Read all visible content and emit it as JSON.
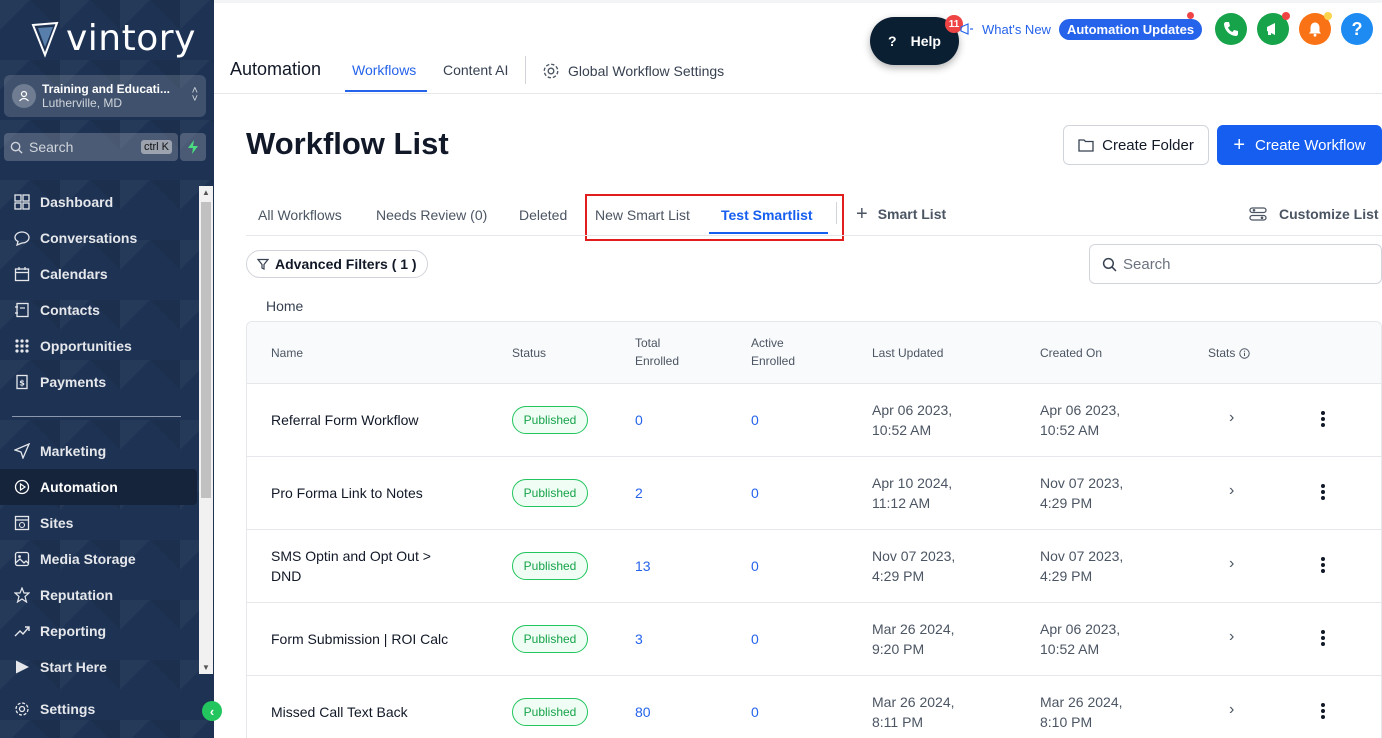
{
  "brand": {
    "name": "vintory"
  },
  "account": {
    "name": "Training and Educati...",
    "location": "Lutherville, MD"
  },
  "sidebar_search": {
    "label": "Search",
    "shortcut": "ctrl K"
  },
  "nav_primary": [
    {
      "label": "Dashboard",
      "icon": "dashboard-icon"
    },
    {
      "label": "Conversations",
      "icon": "chat-icon"
    },
    {
      "label": "Calendars",
      "icon": "calendar-icon"
    },
    {
      "label": "Contacts",
      "icon": "contacts-icon"
    },
    {
      "label": "Opportunities",
      "icon": "opportunities-icon"
    },
    {
      "label": "Payments",
      "icon": "payments-icon"
    }
  ],
  "nav_secondary": [
    {
      "label": "Marketing",
      "icon": "send-icon"
    },
    {
      "label": "Automation",
      "icon": "automation-icon",
      "active": true
    },
    {
      "label": "Sites",
      "icon": "sites-icon"
    },
    {
      "label": "Media Storage",
      "icon": "image-icon"
    },
    {
      "label": "Reputation",
      "icon": "star-icon"
    },
    {
      "label": "Reporting",
      "icon": "trend-icon"
    },
    {
      "label": "Start Here",
      "icon": "play-icon"
    }
  ],
  "settings_label": "Settings",
  "topbar": {
    "title": "Automation",
    "tabs": [
      "Workflows",
      "Content AI"
    ],
    "global_settings": "Global Workflow Settings",
    "help": {
      "label": "Help",
      "badge": "11"
    },
    "whats_new": "What's New",
    "automation_updates": "Automation Updates"
  },
  "page": {
    "title": "Workflow List",
    "create_folder": "Create Folder",
    "create_workflow": "Create Workflow",
    "tabs": [
      "All Workflows",
      "Needs Review (0)",
      "Deleted",
      "New Smart List",
      "Test Smartlist"
    ],
    "add_smart_list": "Smart List",
    "customize_list": "Customize List",
    "advanced_filters": "Advanced Filters ( 1 )",
    "search_placeholder": "Search",
    "breadcrumb": "Home"
  },
  "table": {
    "headers": {
      "name": "Name",
      "status": "Status",
      "total_1": "Total",
      "total_2": "Enrolled",
      "active_1": "Active",
      "active_2": "Enrolled",
      "updated": "Last Updated",
      "created": "Created On",
      "stats": "Stats"
    },
    "rows": [
      {
        "name1": "Referral Form Workflow",
        "name2": "",
        "status": "Published",
        "total": "0",
        "active": "0",
        "updated1": "Apr 06 2023,",
        "updated2": "10:52 AM",
        "created1": "Apr 06 2023,",
        "created2": "10:52 AM"
      },
      {
        "name1": "Pro Forma Link to Notes",
        "name2": "",
        "status": "Published",
        "total": "2",
        "active": "0",
        "updated1": "Apr 10 2024,",
        "updated2": "11:12 AM",
        "created1": "Nov 07 2023,",
        "created2": "4:29 PM"
      },
      {
        "name1": "SMS Optin and Opt Out >",
        "name2": "DND",
        "status": "Published",
        "total": "13",
        "active": "0",
        "updated1": "Nov 07 2023,",
        "updated2": "4:29 PM",
        "created1": "Nov 07 2023,",
        "created2": "4:29 PM"
      },
      {
        "name1": "Form Submission | ROI Calc",
        "name2": "",
        "status": "Published",
        "total": "3",
        "active": "0",
        "updated1": "Mar 26 2024,",
        "updated2": "9:20 PM",
        "created1": "Apr 06 2023,",
        "created2": "10:52 AM"
      },
      {
        "name1": "Missed Call Text Back",
        "name2": "",
        "status": "Published",
        "total": "80",
        "active": "0",
        "updated1": "Mar 26 2024,",
        "updated2": "8:11 PM",
        "created1": "Mar 26 2024,",
        "created2": "8:10 PM"
      }
    ]
  },
  "colors": {
    "accent": "#155eef",
    "sidebar": "#1e3354",
    "published": "#16a34a",
    "highlight": "#e11d1d"
  }
}
